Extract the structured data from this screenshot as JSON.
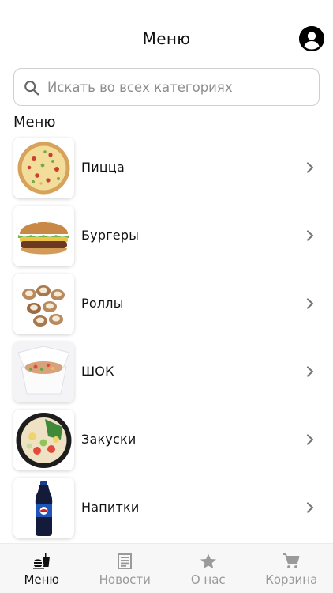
{
  "header": {
    "title": "Меню",
    "account_icon": "account-circle-icon"
  },
  "search": {
    "placeholder": "Искать во всех категориях",
    "icon": "search-icon"
  },
  "section_title": "Меню",
  "categories": [
    {
      "label": "Пицца",
      "thumb": "pizza"
    },
    {
      "label": "Бургеры",
      "thumb": "burger"
    },
    {
      "label": "Роллы",
      "thumb": "rolls"
    },
    {
      "label": "ШОК",
      "thumb": "wok"
    },
    {
      "label": "Закуски",
      "thumb": "snacks"
    },
    {
      "label": "Напитки",
      "thumb": "drinks"
    }
  ],
  "bottom_nav": [
    {
      "label": "Меню",
      "icon": "fastfood-icon",
      "active": true
    },
    {
      "label": "Новости",
      "icon": "newspaper-icon",
      "active": false
    },
    {
      "label": "О нас",
      "icon": "star-icon",
      "active": false
    },
    {
      "label": "Корзина",
      "icon": "cart-icon",
      "active": false
    }
  ],
  "colors": {
    "active_text": "#111111",
    "inactive_text": "#9a9a9a",
    "nav_background": "#f7f7f7"
  }
}
